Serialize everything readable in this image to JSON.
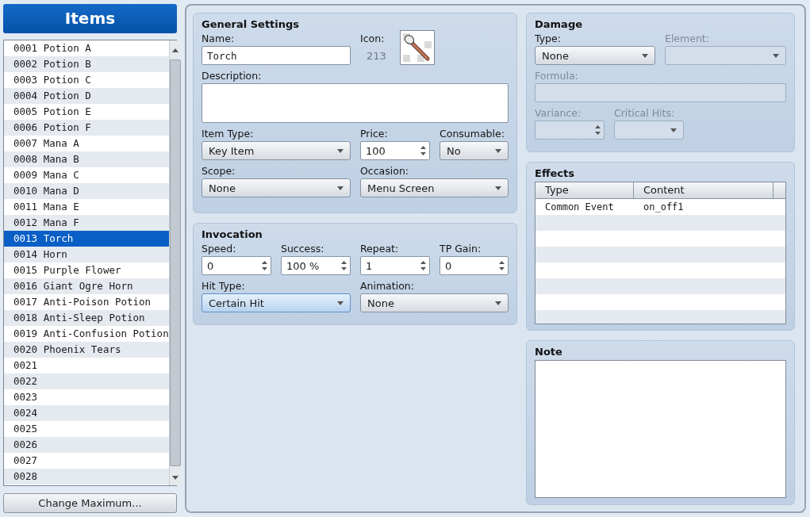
{
  "items_panel": {
    "title": "Items",
    "items": [
      {
        "label": "0001 Potion A",
        "selected": false
      },
      {
        "label": "0002 Potion B",
        "selected": false
      },
      {
        "label": "0003 Potion C",
        "selected": false
      },
      {
        "label": "0004 Potion D",
        "selected": false
      },
      {
        "label": "0005 Potion E",
        "selected": false
      },
      {
        "label": "0006 Potion F",
        "selected": false
      },
      {
        "label": "0007 Mana A",
        "selected": false
      },
      {
        "label": "0008 Mana B",
        "selected": false
      },
      {
        "label": "0009 Mana C",
        "selected": false
      },
      {
        "label": "0010 Mana D",
        "selected": false
      },
      {
        "label": "0011 Mana E",
        "selected": false
      },
      {
        "label": "0012 Mana F",
        "selected": false
      },
      {
        "label": "0013 Torch",
        "selected": true
      },
      {
        "label": "0014 Horn",
        "selected": false
      },
      {
        "label": "0015 Purple Flower",
        "selected": false
      },
      {
        "label": "0016 Giant Ogre Horn",
        "selected": false
      },
      {
        "label": "0017 Anti-Poison Potion",
        "selected": false
      },
      {
        "label": "0018 Anti-Sleep Potion",
        "selected": false
      },
      {
        "label": "0019 Anti-Confusion Potion",
        "selected": false
      },
      {
        "label": "0020 Phoenix Tears",
        "selected": false
      },
      {
        "label": "0021",
        "selected": false
      },
      {
        "label": "0022",
        "selected": false
      },
      {
        "label": "0023",
        "selected": false
      },
      {
        "label": "0024",
        "selected": false
      },
      {
        "label": "0025",
        "selected": false
      },
      {
        "label": "0026",
        "selected": false
      },
      {
        "label": "0027",
        "selected": false
      },
      {
        "label": "0028",
        "selected": false
      }
    ],
    "button": "Change Maximum..."
  },
  "general_settings": {
    "title": "General Settings",
    "fields": [
      {
        "kind": "text",
        "label": "Name:",
        "value": "Torch",
        "disabled": false
      },
      {
        "kind": "icon",
        "label": "Icon:",
        "value": "213"
      },
      {
        "kind": "textarea",
        "label": "Description:",
        "disabled": false
      },
      {
        "kind": "select",
        "label": "Item Type:",
        "value": "Key Item",
        "disabled": false,
        "focused": false
      },
      {
        "kind": "spin",
        "label": "Price:",
        "value": "100",
        "disabled": false
      },
      {
        "kind": "select",
        "label": "Consumable:",
        "value": "No",
        "disabled": false,
        "focused": false
      },
      {
        "kind": "select",
        "label": "Scope:",
        "value": "None",
        "disabled": false,
        "focused": false
      },
      {
        "kind": "select",
        "label": "Occasion:",
        "value": "Menu Screen",
        "disabled": false,
        "focused": false
      }
    ]
  },
  "invocation": {
    "title": "Invocation",
    "fields": [
      {
        "kind": "spin",
        "label": "Speed:",
        "value": "0",
        "disabled": false
      },
      {
        "kind": "spin",
        "label": "Success:",
        "value": "100 %",
        "disabled": false
      },
      {
        "kind": "spin",
        "label": "Repeat:",
        "value": "1",
        "disabled": false
      },
      {
        "kind": "spin",
        "label": "TP Gain:",
        "value": "0",
        "disabled": false
      },
      {
        "kind": "select",
        "label": "Hit Type:",
        "value": "Certain Hit",
        "disabled": false,
        "focused": true
      },
      {
        "kind": "select",
        "label": "Animation:",
        "value": "None",
        "disabled": false,
        "focused": false
      }
    ]
  },
  "damage": {
    "title": "Damage",
    "fields": [
      {
        "kind": "select",
        "label": "Type:",
        "value": "None",
        "disabled": false,
        "focused": false
      },
      {
        "kind": "select",
        "label": "Element:",
        "disabled": true,
        "focused": false
      },
      {
        "kind": "text",
        "label": "Formula:",
        "disabled": true
      },
      {
        "kind": "spin",
        "label": "Variance:",
        "disabled": true
      },
      {
        "kind": "select",
        "label": "Critical Hits:",
        "disabled": true,
        "focused": false
      }
    ]
  },
  "effects": {
    "title": "Effects",
    "columns": [
      "Type",
      "Content"
    ],
    "rows": [
      [
        "Common Event",
        "on_off1"
      ]
    ]
  },
  "note": {
    "title": "Note"
  }
}
